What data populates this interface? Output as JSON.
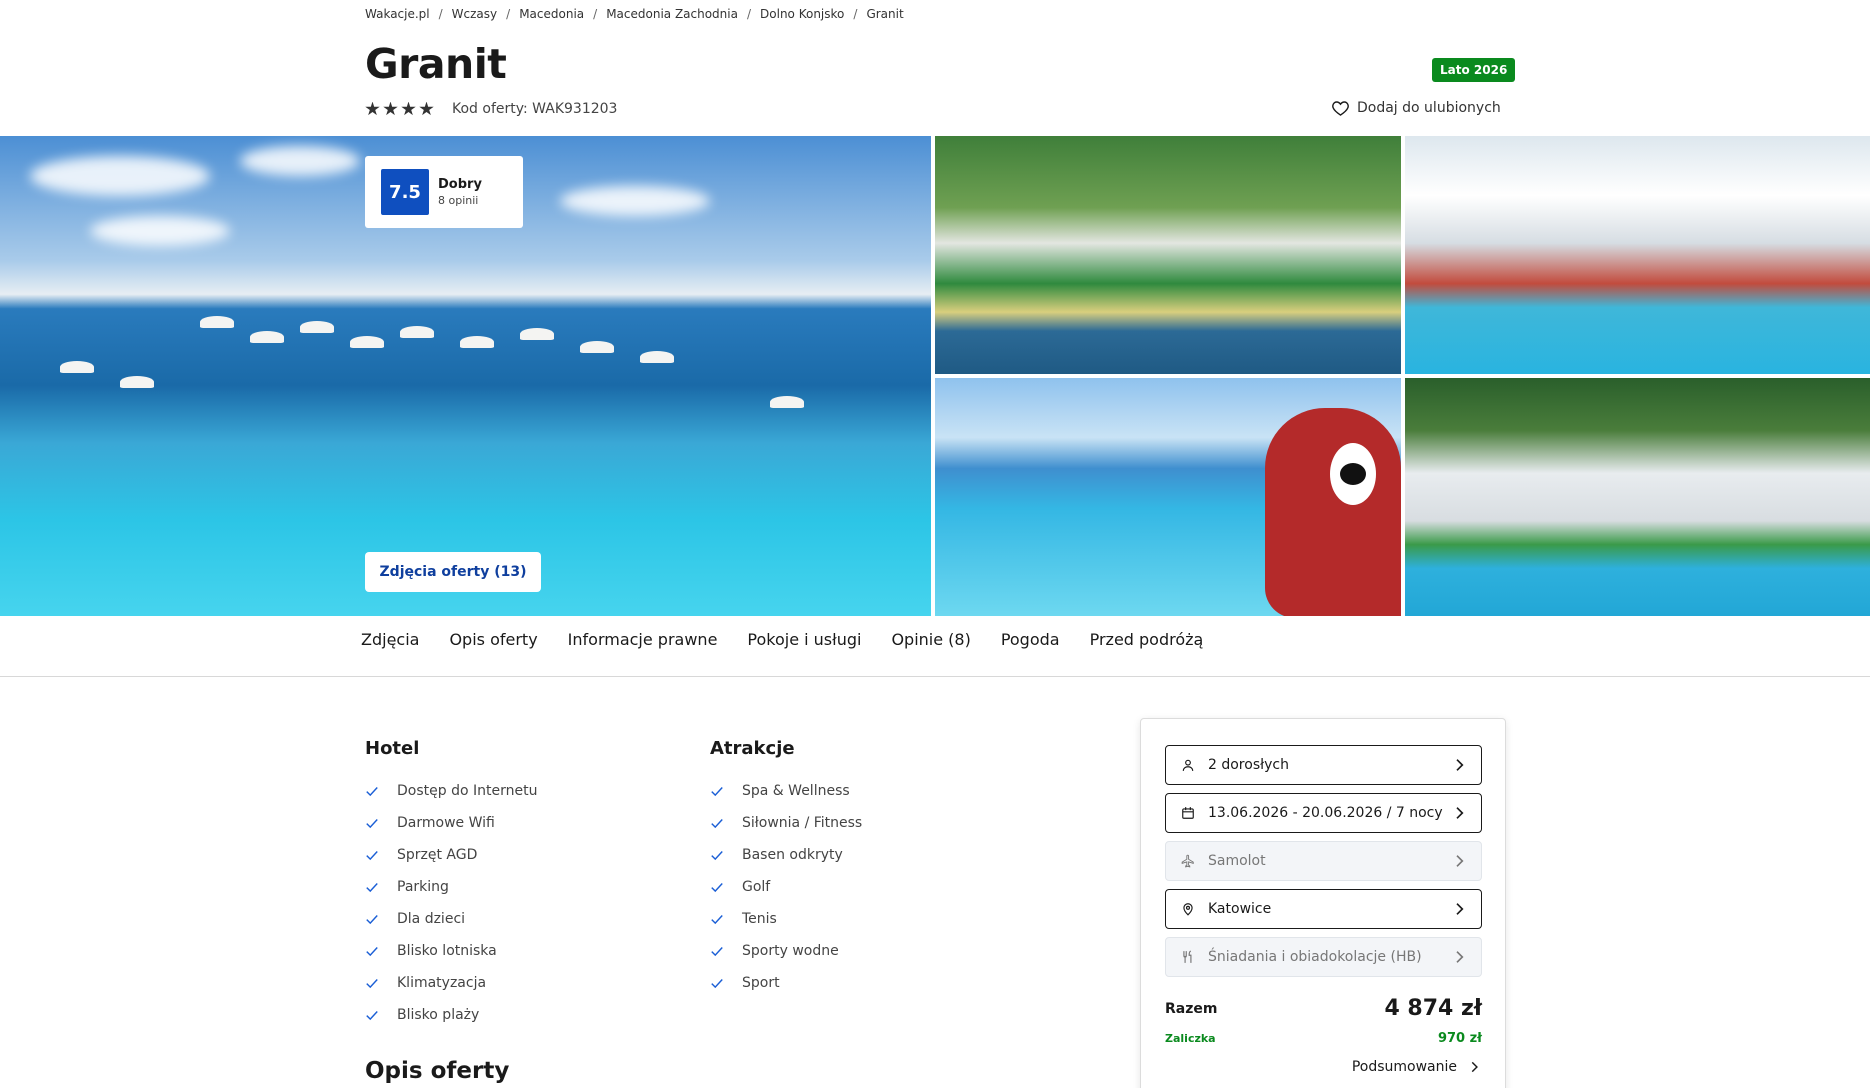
{
  "breadcrumb": [
    "Wakacje.pl",
    "Wczasy",
    "Macedonia",
    "Macedonia Zachodnia",
    "Dolno Konjsko",
    "Granit"
  ],
  "hotel": {
    "name": "Granit",
    "season_badge": "Lato 2026",
    "stars": 4,
    "offer_code": "Kod oferty: WAK931203",
    "favorite_label": "Dodaj do ulubionych"
  },
  "rating": {
    "score": "7.5",
    "label": "Dobry",
    "count": "8 opinii"
  },
  "gallery": {
    "photos_button": "Zdjęcia oferty (13)"
  },
  "tabs": [
    "Zdjęcia",
    "Opis oferty",
    "Informacje prawne",
    "Pokoje i usługi",
    "Opinie (8)",
    "Pogoda",
    "Przed podróżą"
  ],
  "amenities": {
    "hotel_title": "Hotel",
    "hotel_items": [
      "Dostęp do Internetu",
      "Darmowe Wifi",
      "Sprzęt AGD",
      "Parking",
      "Dla dzieci",
      "Blisko lotniska",
      "Klimatyzacja",
      "Blisko plaży"
    ],
    "attractions_title": "Atrakcje",
    "attractions_items": [
      "Spa & Wellness",
      "Siłownia / Fitness",
      "Basen odkryty",
      "Golf",
      "Tenis",
      "Sporty wodne",
      "Sport"
    ]
  },
  "description_title": "Opis oferty",
  "booking": {
    "guests": "2 dorosłych",
    "dates": "13.06.2026 - 20.06.2026 / 7 nocy",
    "transport": "Samolot",
    "departure": "Katowice",
    "board": "Śniadania i obiadokolacje (HB)",
    "total_label": "Razem",
    "total_value": "4 874 zł",
    "deposit_label": "Zaliczka",
    "deposit_value": "970 zł",
    "summary_label": "Podsumowanie"
  },
  "colors": {
    "accent_blue": "#0f4fbf",
    "green": "#0a8a1e",
    "dark_text": "#1a1a1a",
    "check_blue": "#1b5fd6"
  }
}
